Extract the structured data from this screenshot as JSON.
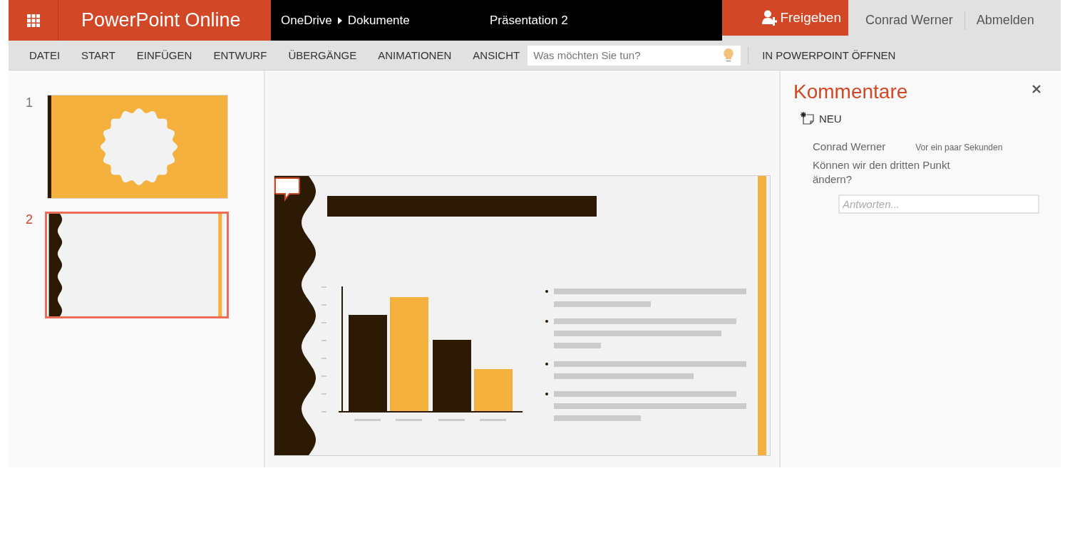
{
  "app": {
    "name": "PowerPoint Online"
  },
  "breadcrumb": [
    "OneDrive",
    "Dokumente"
  ],
  "document_title": "Präsentation 2",
  "share_button": "Freigeben",
  "user": {
    "name": "Conrad Werner",
    "sign_out": "Abmelden"
  },
  "ribbon": {
    "tabs": [
      {
        "label": "DATEI",
        "selected": false
      },
      {
        "label": "START",
        "selected": false
      },
      {
        "label": "EINFÜGEN",
        "selected": false
      },
      {
        "label": "ENTWURF",
        "selected": false
      },
      {
        "label": "ÜBERGÄNGE",
        "selected": false
      },
      {
        "label": "ANIMATIONEN",
        "selected": false
      },
      {
        "label": "ANSICHT",
        "selected": false
      }
    ],
    "search": {
      "placeholder": "Was möchten Sie tun?"
    },
    "open_in_app": "IN POWERPOINT ÖFFNEN"
  },
  "slides": [
    {
      "number": "1",
      "kind": "title",
      "selected": false
    },
    {
      "number": "2",
      "kind": "content",
      "selected": true
    }
  ],
  "comments_pane": {
    "title": "Kommentare",
    "new_button": "NEU",
    "comments": [
      {
        "author": "Conrad Werner",
        "time": "Vor ein paar Sekunden",
        "text": "Können wir den dritten Punkt ändern?"
      }
    ],
    "reply": {
      "placeholder": "Antworten..."
    }
  }
}
